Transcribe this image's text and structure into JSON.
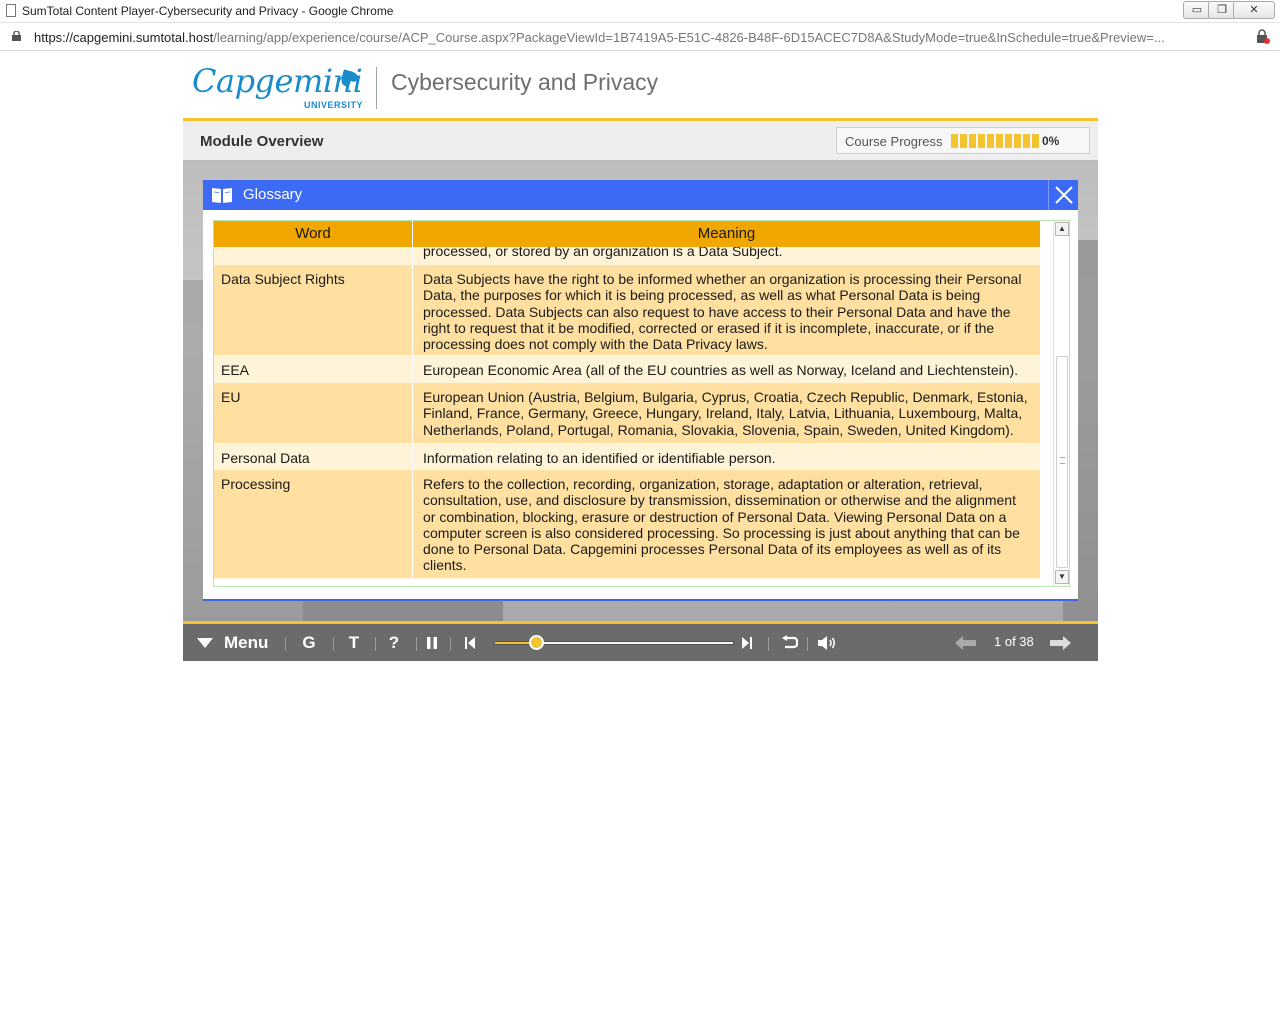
{
  "browser": {
    "window_title": "SumTotal Content Player-Cybersecurity and Privacy - Google Chrome",
    "url_host": "https://capgemini.sumtotal.host",
    "url_path": "/learning/app/experience/course/ACP_Course.aspx?PackageViewId=1B7419A5-E51C-4826-B48F-6D15ACEC7D8A&StudyMode=true&InSchedule=true&Preview=...",
    "minimize_label": "▭",
    "restore_label": "❐",
    "close_label": "✕"
  },
  "header": {
    "brand": "Capgemini",
    "brand_sub": "UNIVERSITY",
    "course_title": "Cybersecurity and Privacy"
  },
  "module": {
    "title": "Module Overview",
    "progress_label": "Course Progress",
    "progress_percent": "0%",
    "progress_value": 0
  },
  "glossary": {
    "title": "Glossary",
    "col_word": "Word",
    "col_meaning": "Meaning",
    "rows": [
      {
        "word": "",
        "meaning": "processed, or stored by an organization is a Data Subject.",
        "style": "light"
      },
      {
        "word": "Data Subject Rights",
        "meaning": "Data Subjects have the right to be informed whether an organization is processing their Personal Data, the purposes for which it is being processed, as well as what Personal Data is being processed. Data Subjects can also request to have access to their Personal Data and have the right to request that it be modified, corrected or erased if it is incomplete, inaccurate, or if the processing does not comply with the Data Privacy laws.",
        "style": "dark"
      },
      {
        "word": "EEA",
        "meaning": "European Economic Area (all of the EU countries as well as Norway, Iceland and Liechtenstein).",
        "style": "light"
      },
      {
        "word": "EU",
        "meaning": "European Union (Austria, Belgium, Bulgaria, Cyprus, Croatia, Czech Republic, Denmark, Estonia, Finland, France, Germany, Greece, Hungary, Ireland, Italy, Latvia, Lithuania, Luxembourg, Malta, Netherlands, Poland, Portugal, Romania, Slovakia, Slovenia, Spain, Sweden, United Kingdom).",
        "style": "dark"
      },
      {
        "word": "Personal Data",
        "meaning": "Information relating to an identified or identifiable person.",
        "style": "light"
      },
      {
        "word": "Processing",
        "meaning": "Refers to the collection, recording, organization, storage, adaptation or alteration, retrieval, consultation, use, and disclosure by transmission, dissemination or otherwise and the alignment or combination, blocking, erasure or destruction of Personal Data. Viewing Personal Data on a computer screen is also considered processing. So processing is just about anything that can be done to Personal Data. Capgemini processes Personal Data of its employees as well as of its clients.",
        "style": "dark"
      }
    ]
  },
  "player": {
    "menu_label": "Menu",
    "glossary_label": "G",
    "transcript_label": "T",
    "help_label": "?",
    "page_indicator": "1 of 38",
    "slider_value": 0.18
  },
  "colors": {
    "accent_yellow": "#f4c430",
    "dialog_blue": "#3d6af5",
    "table_header": "#f0a800",
    "row_dark": "#ffe0a0",
    "row_light": "#fff3d8",
    "brand_blue": "#1a8ccc"
  }
}
